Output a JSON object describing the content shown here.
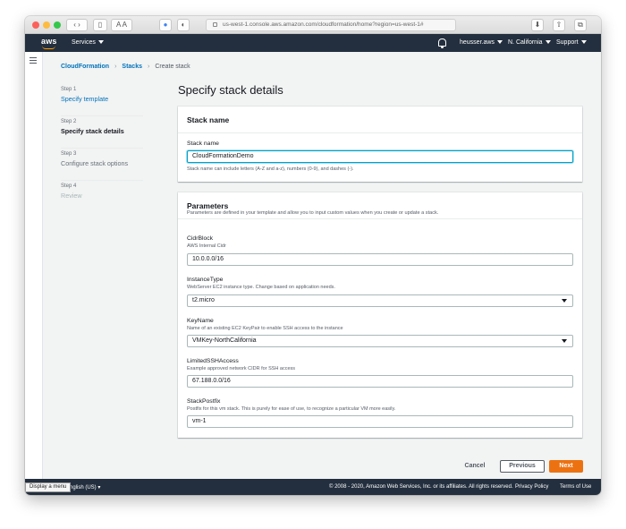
{
  "browser": {
    "url": "us-west-1.console.aws.amazon.com/cloudformation/home?region=us-west-1#"
  },
  "header": {
    "logo": "aws",
    "services_label": "Services",
    "account": "heusser.aws",
    "region": "N. California",
    "support": "Support"
  },
  "breadcrumb": {
    "items": [
      "CloudFormation",
      "Stacks",
      "Create stack"
    ]
  },
  "steps": [
    {
      "num": "Step 1",
      "title": "Specify template"
    },
    {
      "num": "Step 2",
      "title": "Specify stack details"
    },
    {
      "num": "Step 3",
      "title": "Configure stack options"
    },
    {
      "num": "Step 4",
      "title": "Review"
    }
  ],
  "page_title": "Specify stack details",
  "stack_name_panel": {
    "heading": "Stack name",
    "label": "Stack name",
    "value": "CloudFormationDemo",
    "hint": "Stack name can include letters (A-Z and a-z), numbers (0-9), and dashes (-)."
  },
  "parameters_panel": {
    "heading": "Parameters",
    "description": "Parameters are defined in your template and allow you to input custom values when you create or update a stack.",
    "fields": [
      {
        "label": "CidrBlock",
        "desc": "AWS Internal Cidr",
        "value": "10.0.0.0/16"
      },
      {
        "label": "InstanceType",
        "desc": "WebServer EC2 instance type. Change based on application needs.",
        "value": "t2.micro"
      },
      {
        "label": "KeyName",
        "desc": "Name of an existing EC2 KeyPair to enable SSH access to the instance",
        "value": "VMKey-NorthCalifornia"
      },
      {
        "label": "LimitedSSHAccess",
        "desc": "Example approved network CIDR for SSH access",
        "value": "67.188.0.0/16"
      },
      {
        "label": "StackPostfix",
        "desc": "Postfix for this vm stack. This is purely for ease of use, to recognize a particular VM more easily.",
        "value": "vm-1"
      }
    ]
  },
  "actions": {
    "cancel": "Cancel",
    "previous": "Previous",
    "next": "Next"
  },
  "footer": {
    "language": "nglish (US)",
    "copyright": "© 2008 - 2020, Amazon Web Services, Inc. or its affiliates. All rights reserved.",
    "privacy": "Privacy Policy",
    "terms": "Terms of Use",
    "tooltip": "Display a menu"
  },
  "colors": {
    "header_bg": "#232f3e",
    "link": "#0073bb",
    "primary_button": "#ec7211",
    "focus": "#00a1c9"
  }
}
